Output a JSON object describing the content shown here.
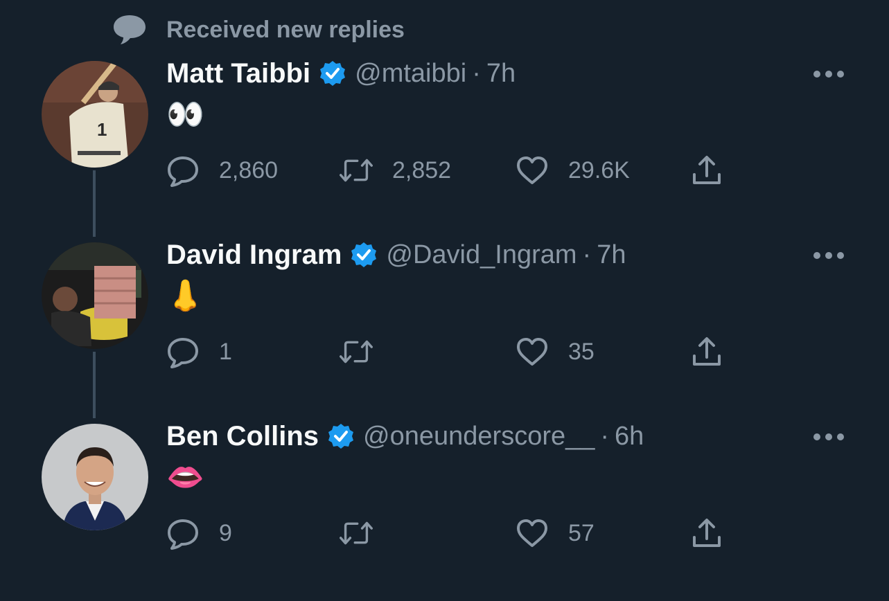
{
  "banner": {
    "icon": "speech-bubble-icon",
    "text": "Received new replies"
  },
  "colors": {
    "background": "#15202b",
    "secondary_text": "#8b98a5",
    "verified": "#1d9bf0",
    "thread_line": "#3d4e5e"
  },
  "tweets": [
    {
      "name": "Matt Taibbi",
      "handle": "@mtaibbi",
      "sep": "·",
      "time": "7h",
      "text": "👀",
      "replies": "2,860",
      "retweets": "2,852",
      "likes": "29.6K"
    },
    {
      "name": "David Ingram",
      "handle": "@David_Ingram",
      "sep": "·",
      "time": "7h",
      "text": "👃",
      "replies": "1",
      "retweets": "",
      "likes": "35"
    },
    {
      "name": "Ben Collins",
      "handle": "@oneunderscore__",
      "sep": "·",
      "time": "6h",
      "text": "👄",
      "replies": "9",
      "retweets": "",
      "likes": "57"
    }
  ]
}
